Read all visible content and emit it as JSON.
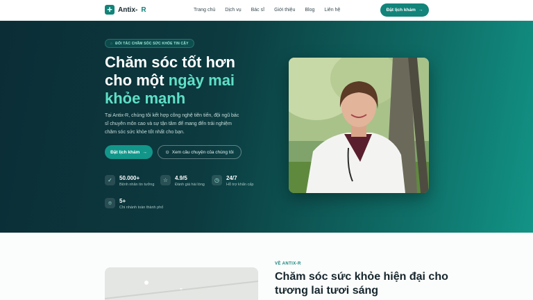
{
  "nav": {
    "logo_text": "Antix-",
    "logo_accent": "R",
    "items": [
      "Trang chủ",
      "Dịch vụ",
      "Bác sĩ",
      "Giới thiệu",
      "Blog",
      "Liên hệ"
    ],
    "cta": "Đặt lịch khám"
  },
  "hero": {
    "tag": "ĐỐI TÁC CHĂM SÓC SỨC KHỎE TIN CẬY",
    "title_line1": "Chăm sóc tốt hơn",
    "title_line2_plain": "cho một ",
    "title_line2_accent": "ngày mai",
    "title_line3_accent": "khỏe mạnh",
    "description": "Tại Antix-R, chúng tôi kết hợp công nghệ tiên tiến, đội ngũ bác sĩ chuyên môn cao và sự tận tâm để mang đến trải nghiệm chăm sóc sức khỏe tốt nhất cho bạn.",
    "primary_button": "Đặt lịch khám",
    "secondary_button": "Xem câu chuyện của chúng tôi",
    "stats": [
      {
        "value": "50.000+",
        "label": "Bệnh nhân tin tưởng",
        "icon": "heart-check-icon"
      },
      {
        "value": "4.9/5",
        "label": "Đánh giá hài lòng",
        "icon": "star-icon"
      },
      {
        "value": "24/7",
        "label": "Hỗ trợ khẩn cấp",
        "icon": "clock-icon"
      },
      {
        "value": "5+",
        "label": "Chi nhánh toàn thành phố",
        "icon": "location-pin-icon"
      }
    ]
  },
  "about": {
    "eyebrow": "VỀ ANTIX-R",
    "title": "Chăm sóc sức khỏe hiện đại cho tương lai tươi sáng"
  },
  "colors": {
    "brand": "#12847a",
    "accent": "#5fe0c6",
    "hero_dark": "#0b2d36"
  }
}
